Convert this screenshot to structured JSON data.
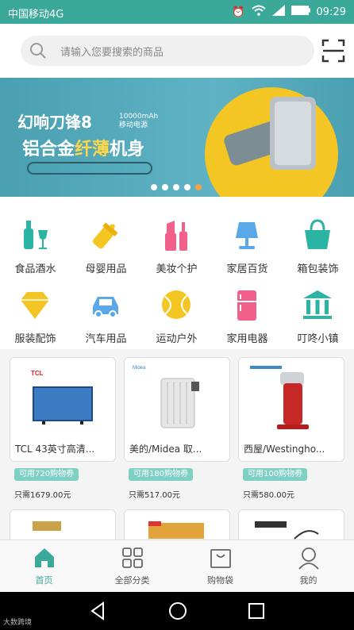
{
  "status": {
    "carrier": "中国移动4G",
    "time": "09:29"
  },
  "search": {
    "placeholder": "请输入您要搜索的商品"
  },
  "banner": {
    "line1": "幻响刀锋8",
    "line1_small": "10000mAh 移动电源",
    "line2_a": "铝合金",
    "line2_b": "纤薄",
    "line2_c": "机身",
    "dot_count": 5,
    "active_dot": 4
  },
  "categories": [
    {
      "label": "食品酒水",
      "icon": "wine-bottle-icon",
      "color": "#2bb3a3"
    },
    {
      "label": "母婴用品",
      "icon": "baby-bottle-icon",
      "color": "#f4c624"
    },
    {
      "label": "美妆个护",
      "icon": "lipstick-icon",
      "color": "#f0608a"
    },
    {
      "label": "家居百货",
      "icon": "lamp-icon",
      "color": "#5aa8e8"
    },
    {
      "label": "箱包装饰",
      "icon": "handbag-icon",
      "color": "#2bb3a3"
    },
    {
      "label": "服装配饰",
      "icon": "diamond-icon",
      "color": "#f4c624"
    },
    {
      "label": "汽车用品",
      "icon": "car-icon",
      "color": "#5aa8e8"
    },
    {
      "label": "运动户外",
      "icon": "tennis-ball-icon",
      "color": "#f4c624"
    },
    {
      "label": "家用电器",
      "icon": "fridge-icon",
      "color": "#f0608a"
    },
    {
      "label": "叮咚小镇",
      "icon": "bank-building-icon",
      "color": "#2bb3a3"
    }
  ],
  "products": [
    {
      "name": "TCL 43英寸高清...",
      "coupon": "可用720购物券",
      "price": "只需1679.00元"
    },
    {
      "name": "美的/Midea 取...",
      "coupon": "可用180购物券",
      "price": "只需517.00元"
    },
    {
      "name": "西屋/Westingho...",
      "coupon": "可用100购物券",
      "price": "只需580.00元"
    }
  ],
  "tabs": [
    {
      "label": "首页",
      "icon": "home-icon",
      "active": true
    },
    {
      "label": "全部分类",
      "icon": "grid-icon",
      "active": false
    },
    {
      "label": "购物袋",
      "icon": "shopping-bag-icon",
      "active": false
    },
    {
      "label": "我的",
      "icon": "user-icon",
      "active": false
    }
  ],
  "watermark": "大数跨境"
}
